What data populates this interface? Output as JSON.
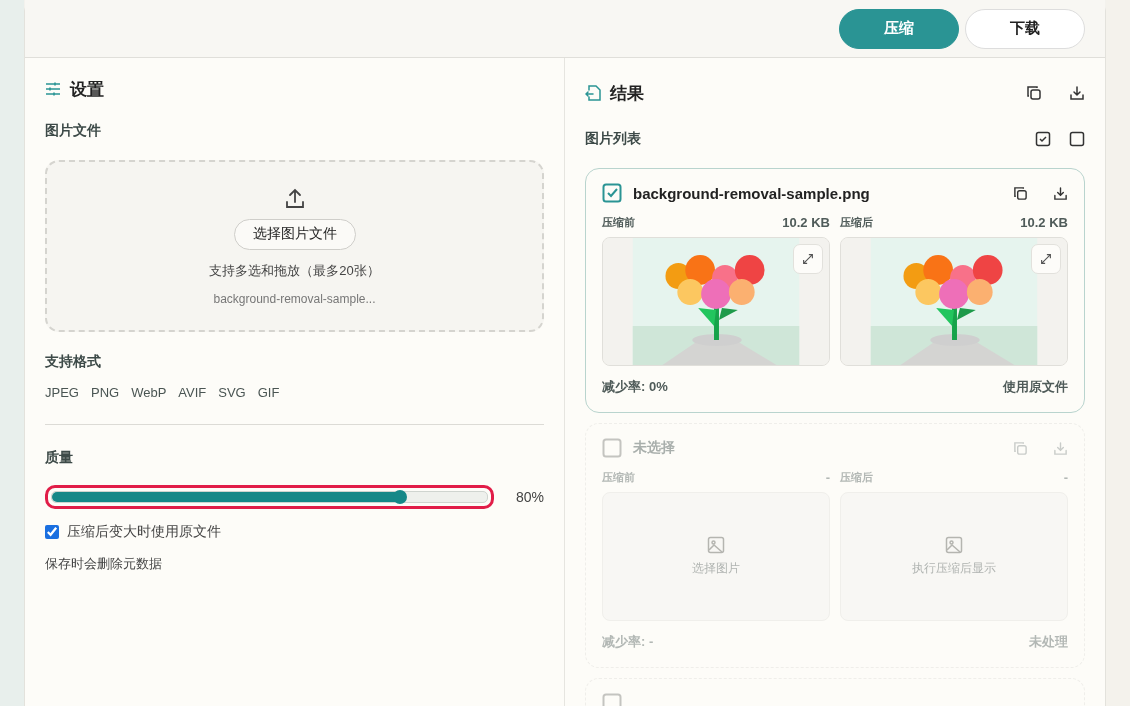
{
  "toolbar": {
    "buttons": [
      {
        "label": "压缩",
        "kind": "primary"
      },
      {
        "label": "下载",
        "kind": "secondary"
      }
    ]
  },
  "settings": {
    "title": "设置",
    "file_label": "图片文件",
    "choose_button": "选择图片文件",
    "drop_hint": "支持多选和拖放（最多20张）",
    "file_name": "background-removal-sample...",
    "formats_label": "支持格式",
    "formats": [
      "JPEG",
      "PNG",
      "WebP",
      "AVIF",
      "SVG",
      "GIF"
    ],
    "quality_label": "质量",
    "quality": {
      "level": 0.8,
      "reading": "80%",
      "highlighted": true
    },
    "keep_original": {
      "label": "压缩后变大时使用原文件",
      "checked": true
    },
    "note": "保存时会删除元数据"
  },
  "results": {
    "title": "结果",
    "list_label": "图片列表",
    "items": [
      {
        "kind": "filled",
        "selected": true,
        "name": "background-removal-sample.png",
        "before_label": "压缩前",
        "before_size": "10.2 KB",
        "after_label": "压缩后",
        "after_size": "10.2 KB",
        "rate": "减少率: 0%",
        "status": "使用原文件"
      },
      {
        "kind": "empty",
        "selected": false,
        "name": "未选择",
        "before_label": "压缩前",
        "before_size": "-",
        "after_label": "压缩后",
        "after_size": "-",
        "before_hint": "选择图片",
        "after_hint": "执行压缩后显示",
        "rate": "减少率: -",
        "status": "未处理"
      },
      {
        "kind": "stub",
        "selected": false
      }
    ]
  }
}
